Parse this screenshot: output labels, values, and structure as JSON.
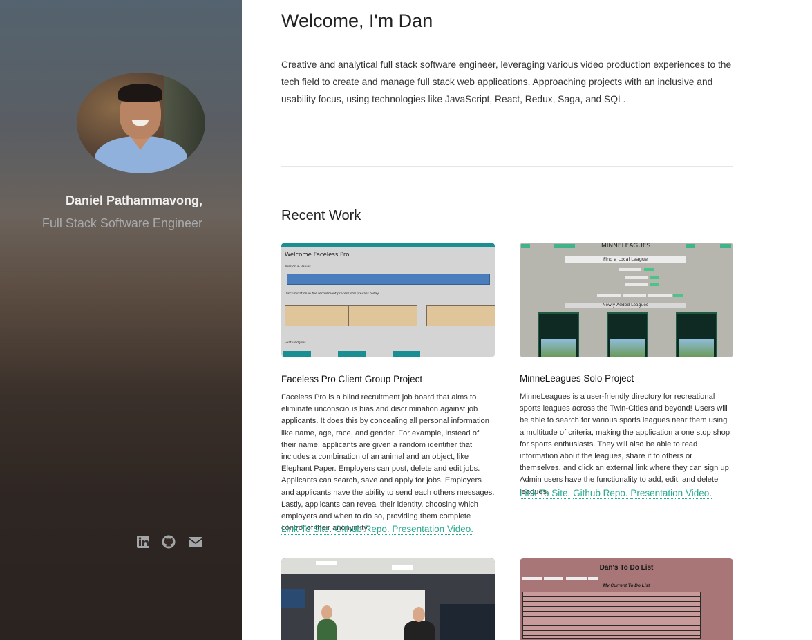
{
  "sidebar": {
    "name": "Daniel Pathammavong,",
    "title": "Full Stack Software Engineer",
    "avatar_alt": "Profile photo of Dan",
    "social": [
      {
        "icon": "linkedin-icon"
      },
      {
        "icon": "github-icon"
      },
      {
        "icon": "envelope-icon"
      }
    ]
  },
  "main": {
    "welcome": "Welcome, I'm Dan",
    "intro": "Creative and analytical full stack software engineer, leveraging various video production experiences to the tech field to create and manage full stack web applications. Approaching projects with an inclusive and usability focus, using technologies like JavaScript, React, Redux, Saga, and SQL.",
    "recent_heading": "Recent Work",
    "projects": [
      {
        "title": "Faceless Pro Client Group Project",
        "description": "Faceless Pro is a blind recruitment job board that aims to eliminate unconscious bias and discrimination against job applicants. It does this by concealing all personal information like name, age, race, and gender. For example, instead of their name, applicants are given a random identifier that includes a combination of an animal and an object, like Elephant Paper. Employers can post, delete and edit jobs. Applicants can search, save and apply for jobs. Employers and applicants have the ability to send each others messages. Lastly, applicants can reveal their identity, choosing which employers and when to do so, providing them complete control of their anonymity.",
        "links": [
          "Link To Site.",
          "Github Repo.",
          "Presentation Video."
        ],
        "thumb": {
          "heading": "Welcome Faceless Pro",
          "subheading": "Mission & Values",
          "note": "Discrimination in the recruitment process still prevails today",
          "footer": "Featured Jobs"
        }
      },
      {
        "title": "MinneLeagues Solo Project",
        "description": "MinneLeagues is a user-friendly directory for recreational sports leagues across the Twin-Cities and beyond! Users will be able to search for various sports leagues near them using a multitude of criteria, making the application a one stop shop for sports enthusiasts. They will also be able to read information about the leagues, share it to others or themselves, and click an external link where they can sign up. Admin users have the functionality to add, edit, and delete leagues.",
        "links": [
          "Link To Site.",
          "Github Repo.",
          "Presentation Video."
        ],
        "thumb": {
          "logo": "MINNELEAGUES",
          "find": "Find a Local League",
          "new": "Newly Added Leagues"
        }
      },
      {
        "title": "",
        "thumb": {
          "kind": "photo"
        }
      },
      {
        "title": "",
        "thumb": {
          "heading": "Dan's To Do List",
          "subheading": "My Current To Do List"
        }
      }
    ]
  },
  "colors": {
    "accent": "#27a98f",
    "sidebar_text": "#f2f2f2",
    "sidebar_subtext": "#a7a9ab"
  }
}
